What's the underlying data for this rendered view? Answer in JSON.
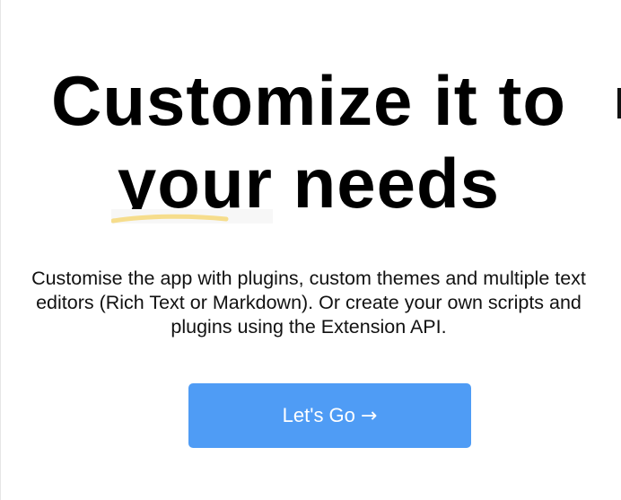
{
  "hero": {
    "headline_line1": "Customize it to",
    "headline_word_highlight": "your",
    "headline_word_rest": " needs",
    "subtitle": "Customise the app with plugins, custom themes and multiple text editors (Rich Text or Markdown). Or create your own scripts and plugins using the Extension API.",
    "cta_label": "Let's Go",
    "cta_icon": "arrow-right-icon",
    "cta_arrow": "→"
  },
  "colors": {
    "button_background": "#4f9cf5",
    "button_text": "#ffffff",
    "headline_text": "#000000",
    "underline_swash": "#f6dd8c"
  }
}
